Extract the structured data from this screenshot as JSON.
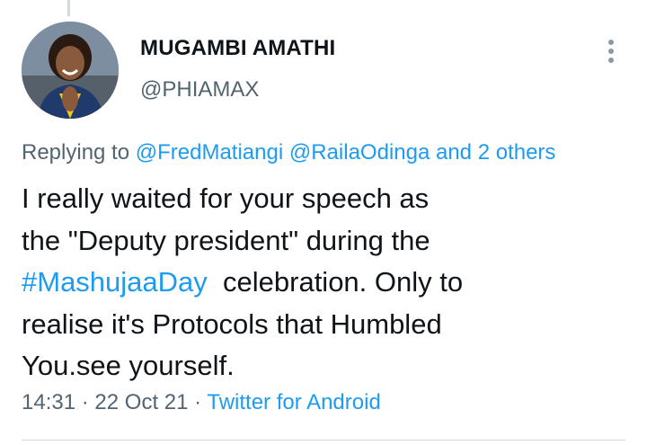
{
  "author": {
    "name": "MUGAMBI AMATHI",
    "handle": "@PHIAMAX"
  },
  "icons": {
    "more": "more-options-icon",
    "avatar": "user-avatar"
  },
  "reply": {
    "prefix": "Replying to",
    "mention1": "@FredMatiangi",
    "mention2": "@RailaOdinga",
    "others": "and 2 others"
  },
  "tweet": {
    "line1": "I really waited for your speech as",
    "line2": "the \"Deputy president\" during the",
    "hashtag": "#MashujaaDay",
    "line3_rest": "  celebration. Only to",
    "line4": "realise it's Protocols that Humbled",
    "line5": "You.see yourself."
  },
  "meta": {
    "time": "14:31",
    "date": "22 Oct 21",
    "source": "Twitter for Android",
    "separator": "·"
  },
  "colors": {
    "link": "#1d9bf0",
    "text": "#0f1419",
    "secondary": "#536471"
  }
}
